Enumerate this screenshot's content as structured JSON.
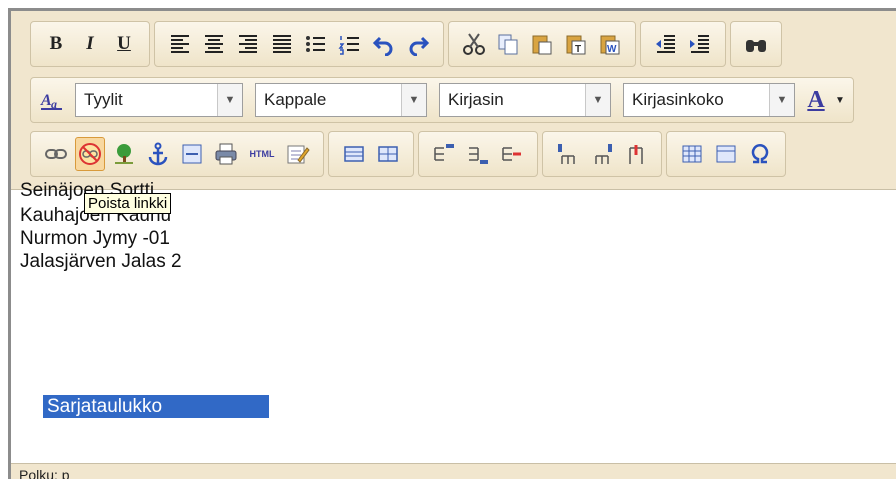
{
  "toolbar_row1": {
    "bold_label": "B",
    "italic_label": "I",
    "underline_label": "U"
  },
  "toolbar_row2": {
    "styles_select": "Tyylit",
    "format_select": "Kappale",
    "font_select": "Kirjasin",
    "fontsize_select": "Kirjasinkoko",
    "text_color_label": "A"
  },
  "toolbar_row3": {
    "html_label": "HTML"
  },
  "tooltip": {
    "text": "Poista linkki"
  },
  "content": {
    "partial_line": "Seinäjoen Sortti",
    "lines": [
      "Kauhajoen Kauhu",
      "Nurmon Jymy -01",
      "Jalasjärven Jalas 2"
    ],
    "selected_text": "Sarjataulukko"
  },
  "status": {
    "path": "Polku: p"
  },
  "colors": {
    "toolbar_bg": "#f1e6ce",
    "selection": "#3169c6",
    "accent": "#3c3ca0"
  }
}
